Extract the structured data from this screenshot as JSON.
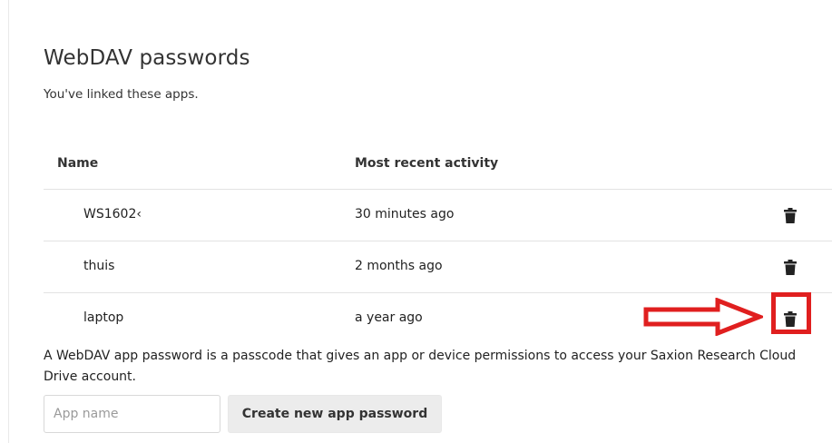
{
  "section": {
    "title": "WebDAV passwords",
    "subtitle": "You've linked these apps."
  },
  "table": {
    "columns": {
      "name": "Name",
      "activity": "Most recent activity"
    },
    "rows": [
      {
        "name": "WS1602‹",
        "activity": "30 minutes ago",
        "action_icon": "trash-icon"
      },
      {
        "name": "thuis",
        "activity": "2 months ago",
        "action_icon": "trash-icon"
      },
      {
        "name": "laptop",
        "activity": "a year ago",
        "action_icon": "trash-icon"
      }
    ]
  },
  "annotation": {
    "color": "#e01f1f",
    "arrow_icon": "right-arrow-icon"
  },
  "description": "A WebDAV app password is a passcode that gives an app or device permissions to access your Saxion Research Cloud Drive account.",
  "form": {
    "app_name_placeholder": "App name",
    "app_name_value": "",
    "create_button_label": "Create new app password"
  }
}
